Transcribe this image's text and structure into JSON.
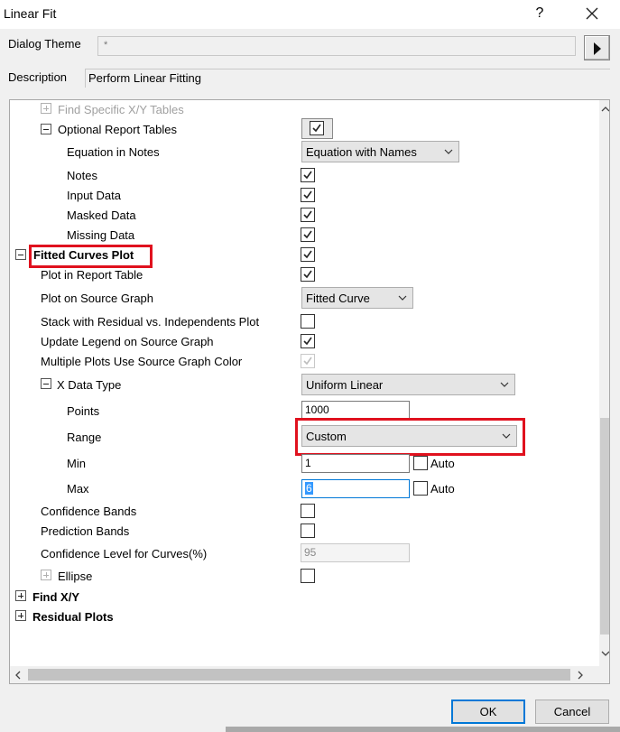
{
  "window": {
    "title": "Linear Fit",
    "help_glyph": "?",
    "close_icon": "close-icon"
  },
  "theme": {
    "label": "Dialog Theme",
    "value": "*"
  },
  "description": {
    "label": "Description",
    "value": "Perform Linear Fitting"
  },
  "tree": {
    "find_specific": "Find Specific X/Y Tables",
    "optional_report": "Optional Report Tables",
    "equation_in_notes": "Equation in Notes",
    "equation_value": "Equation with Names",
    "notes": "Notes",
    "input_data": "Input Data",
    "masked_data": "Masked Data",
    "missing_data": "Missing Data",
    "fitted_curves_plot": "Fitted Curves Plot",
    "plot_in_report": "Plot in Report Table",
    "plot_on_source": "Plot on Source Graph",
    "plot_on_source_value": "Fitted Curve",
    "stack_residual": "Stack with Residual vs. Independents Plot",
    "update_legend": "Update Legend on Source Graph",
    "multiple_plots_color": "Multiple Plots Use Source Graph Color",
    "x_data_type": "X Data Type",
    "x_data_type_value": "Uniform Linear",
    "points": "Points",
    "points_value": "1000",
    "range": "Range",
    "range_value": "Custom",
    "min": "Min",
    "min_value": "1",
    "max": "Max",
    "max_value": "6",
    "auto": "Auto",
    "confidence_bands": "Confidence Bands",
    "prediction_bands": "Prediction Bands",
    "confidence_level": "Confidence Level for Curves(%)",
    "confidence_level_value": "95",
    "ellipse": "Ellipse",
    "find_xy": "Find X/Y",
    "residual_plots": "Residual Plots"
  },
  "buttons": {
    "ok": "OK",
    "cancel": "Cancel"
  },
  "colors": {
    "highlight_box": "#e0111e",
    "focus": "#0078d7",
    "selection": "#3399ff"
  }
}
